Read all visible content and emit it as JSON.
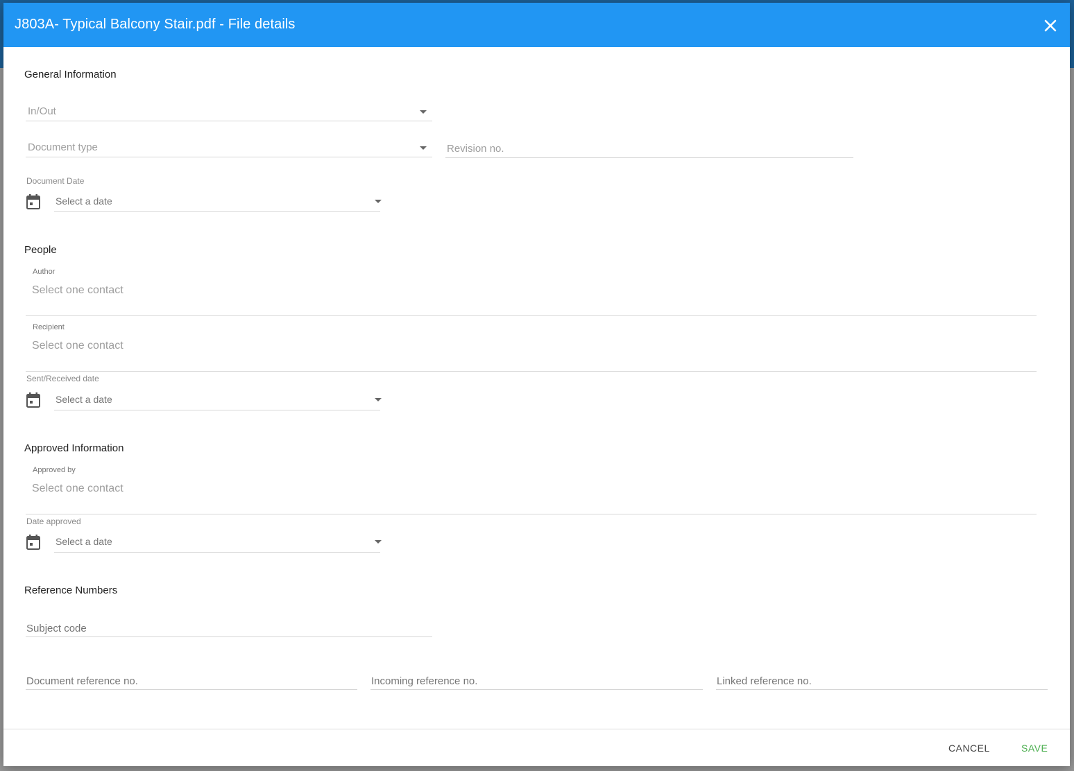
{
  "dialog": {
    "title": "J803A- Typical Balcony Stair.pdf - File details",
    "close_icon": "close-icon"
  },
  "general": {
    "heading": "General Information",
    "in_out": {
      "placeholder": "In/Out"
    },
    "document_type": {
      "placeholder": "Document type"
    },
    "revision_no": {
      "placeholder": "Revision no."
    },
    "document_date": {
      "label": "Document Date",
      "placeholder": "Select a date"
    }
  },
  "people": {
    "heading": "People",
    "author": {
      "label": "Author",
      "placeholder": "Select one contact"
    },
    "recipient": {
      "label": "Recipient",
      "placeholder": "Select one contact"
    },
    "sent_received_date": {
      "label": "Sent/Received date",
      "placeholder": "Select a date"
    }
  },
  "approved": {
    "heading": "Approved Information",
    "approved_by": {
      "label": "Approved by",
      "placeholder": "Select one contact"
    },
    "date_approved": {
      "label": "Date approved",
      "placeholder": "Select a date"
    }
  },
  "references": {
    "heading": "Reference Numbers",
    "subject_code": {
      "placeholder": "Subject code"
    },
    "document_reference": {
      "placeholder": "Document reference no."
    },
    "incoming_reference": {
      "placeholder": "Incoming reference no."
    },
    "linked_reference": {
      "placeholder": "Linked reference no."
    }
  },
  "footer": {
    "cancel_label": "CANCEL",
    "save_label": "SAVE"
  },
  "colors": {
    "header": "#2196f3",
    "save": "#4caf50"
  }
}
